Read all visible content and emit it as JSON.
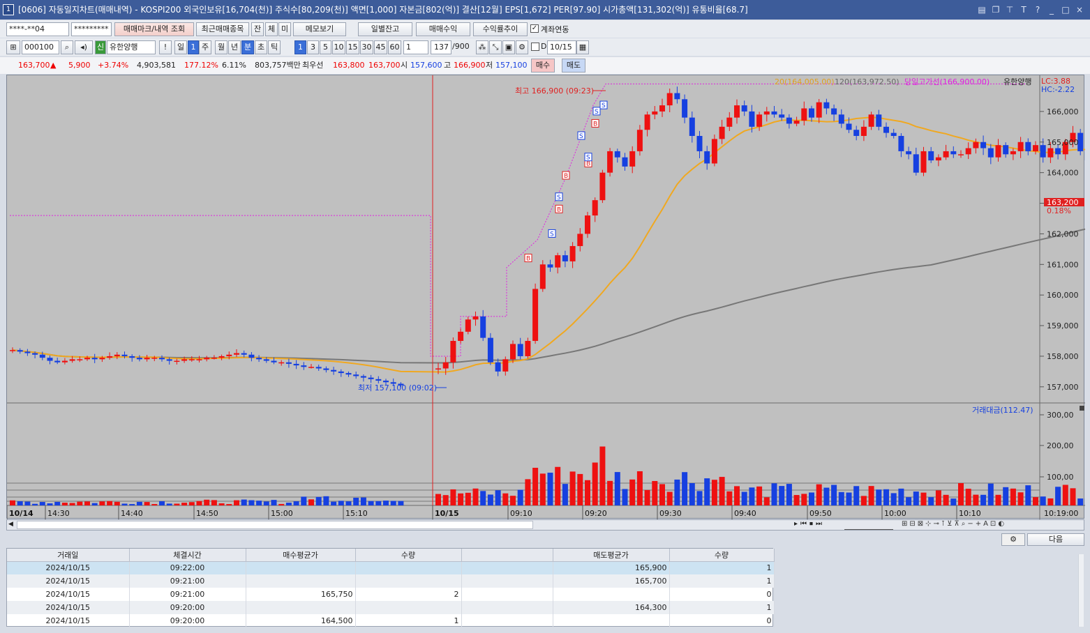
{
  "window": {
    "icon": "1",
    "title": "[0606] 자동일지차트(매매내역) - KOSPI200 외국인보유[16,704(천)] 주식수[80,209(천)] 액면[1,000] 자본금[802(억)] 결산[12월] EPS[1,672] PER[97.90] 시가총액[131,302(억)] 유통비율[68.7]"
  },
  "toolbar1": {
    "account": "****-**04",
    "password": "*********",
    "btn_mark": "매매마크/내역 조회",
    "btn_recent": "최근매매종목",
    "btn_jan": "잔",
    "btn_che": "체",
    "btn_mi": "미",
    "btn_memo": "메모보기",
    "btn_daily": "일별잔고",
    "btn_profit": "매매수익",
    "btn_rate": "수익률추이",
    "chk_link": "계좌연동"
  },
  "toolbar2": {
    "code": "000100",
    "badge": "신",
    "stock_name": "유한양행",
    "tabs": [
      "일",
      "1",
      "주",
      "월",
      "년",
      "분",
      "초",
      "틱"
    ],
    "intervals": [
      "1",
      "3",
      "5",
      "10",
      "15",
      "30",
      "45",
      "60"
    ],
    "period": "1",
    "count": "137",
    "total": "/900",
    "chk_d": "D",
    "date": "10/15"
  },
  "pricebar": {
    "price": "163,700",
    "arrow": "▲",
    "change": "5,900",
    "rate": "+3.74%",
    "volume": "4,903,581",
    "vol_ratio": "177.12%",
    "turnover": "6.11%",
    "amount": "803,757백만",
    "best_label": "최우선",
    "best_ask": "163,800",
    "best_bid": "163,700",
    "open_label": "시",
    "open": "157,600",
    "high_label": "고",
    "high": "166,900",
    "low_label": "저",
    "low": "157,100",
    "buy": "매수",
    "sell": "매도"
  },
  "chart": {
    "legend_ma20": "20(164,005.00)",
    "legend_ma120": "120(163,972.50)",
    "legend_high_line": "당일고가선(166,900.00)",
    "legend_stock": "유한양행",
    "lc": "LC:3.88",
    "hc": "HC:-2.22",
    "high_annot": "최고 166,900 (09:23)",
    "low_annot": "최저 157,100 (09:02)",
    "cur_price_tag": "163,200",
    "cur_pct": "0.18%",
    "price_ticks": [
      "166,000",
      "165,000",
      "164,000",
      "163,000",
      "162,000",
      "161,000",
      "160,000",
      "159,000",
      "158,000",
      "157,000"
    ],
    "vol_legend": "거래대금(112.47)",
    "vol_ticks": [
      "300,00",
      "200,00",
      "100,00"
    ],
    "time_labels": [
      "10/14",
      "14:30",
      "14:40",
      "14:50",
      "15:00",
      "15:10",
      "10/15",
      "09:10",
      "09:20",
      "09:30",
      "09:40",
      "09:50",
      "10:00",
      "10:10"
    ],
    "end_time": "10:19:00"
  },
  "colors": {
    "up": "#ee1111",
    "down": "#1640e0",
    "ma20": "#f0a820",
    "ma120": "#777777",
    "highline": "#e020e0"
  },
  "bottom": {
    "settings": "⚙",
    "next": "다음"
  },
  "grid": {
    "headers": [
      "거래일",
      "체결시간",
      "매수평균가",
      "수량",
      "",
      "매도평균가",
      "수량"
    ],
    "rows": [
      [
        "2024/10/15",
        "09:22:00",
        "",
        "",
        "",
        "165,900",
        "1"
      ],
      [
        "2024/10/15",
        "09:21:00",
        "",
        "",
        "",
        "165,700",
        "1"
      ],
      [
        "2024/10/15",
        "09:21:00",
        "165,750",
        "2",
        "",
        "",
        "0"
      ],
      [
        "2024/10/15",
        "09:20:00",
        "",
        "",
        "",
        "164,300",
        "1"
      ],
      [
        "2024/10/15",
        "09:20:00",
        "164,500",
        "1",
        "",
        "",
        "0"
      ]
    ]
  },
  "chart_data": {
    "type": "candlestick",
    "title": "유한양행",
    "ylim": [
      156700,
      167000
    ],
    "prev_session": {
      "date": "10/14",
      "closes": [
        158200,
        158150,
        158100,
        158050,
        157950,
        157850,
        157800,
        157850,
        157900,
        157900,
        157950,
        157900,
        157950,
        158000,
        158050,
        158000,
        157950,
        157900,
        157950,
        157950,
        157900,
        157850,
        157850,
        157900,
        157900,
        157900,
        157950,
        157950,
        158000,
        158050,
        158100,
        158050,
        157950,
        157900,
        157850,
        157800,
        157800,
        157750,
        157700,
        157650,
        157650,
        157600,
        157550,
        157500,
        157450,
        157400,
        157350,
        157300,
        157250,
        157200,
        157150,
        157100,
        157050
      ]
    },
    "session": {
      "date": "10/15",
      "open": 157600,
      "high": 166900,
      "low": 157100,
      "close": 163200,
      "high_time": "09:23",
      "low_time": "09:02"
    }
  }
}
